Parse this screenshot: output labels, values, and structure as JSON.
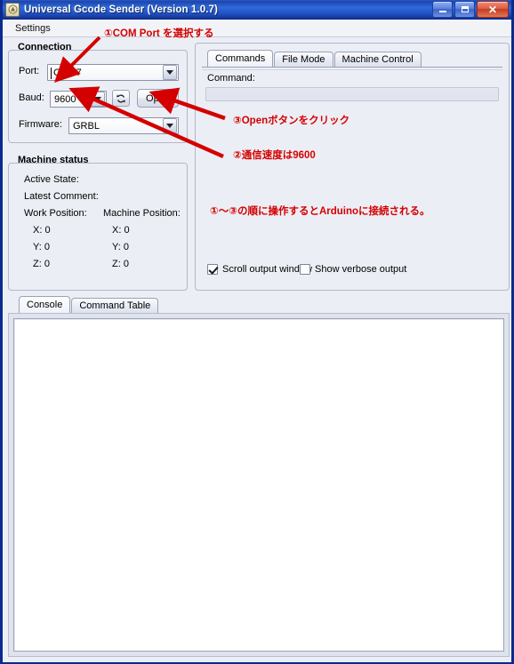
{
  "window": {
    "title": "Universal Gcode Sender (Version 1.0.7)",
    "app_icon": "gcode-app-icon",
    "minimize_label": "–",
    "maximize_label": "□",
    "close_label": "✕",
    "title_bar_color": "#1f4fc0",
    "close_button_color": "#c43c20"
  },
  "menubar": {
    "items": [
      {
        "label": "Settings"
      }
    ]
  },
  "connection": {
    "group_title": "Connection",
    "port": {
      "label": "Port:",
      "value": "COM7",
      "icon": "chevron-down-icon"
    },
    "baud": {
      "label": "Baud:",
      "value": "9600",
      "icon": "chevron-down-icon"
    },
    "firmware": {
      "label": "Firmware:",
      "value": "GRBL",
      "icon": "chevron-down-icon"
    },
    "refresh_icon": "refresh-icon",
    "open_button": "Open"
  },
  "machine_status": {
    "group_title": "Machine status",
    "active_state_label": "Active State:",
    "active_state_value": "",
    "latest_comment_label": "Latest Comment:",
    "latest_comment_value": "",
    "work_position_label": "Work Position:",
    "machine_position_label": "Machine Position:",
    "work": {
      "x": "X:  0",
      "y": "Y:  0",
      "z": "Z:  0"
    },
    "machine": {
      "x": "X:  0",
      "y": "Y:  0",
      "z": "Z:  0"
    }
  },
  "right_panel": {
    "tabs": [
      {
        "label": "Commands",
        "active": true
      },
      {
        "label": "File Mode",
        "active": false
      },
      {
        "label": "Machine Control",
        "active": false
      }
    ],
    "command_label": "Command:",
    "command_value": "",
    "checkboxes": [
      {
        "label": "Scroll output window",
        "checked": true
      },
      {
        "label": "Show verbose output",
        "checked": false
      }
    ]
  },
  "console": {
    "tabs": [
      {
        "label": "Console",
        "active": true
      },
      {
        "label": "Command Table",
        "active": false
      }
    ],
    "content": ""
  },
  "annotations": {
    "color": "#d40000",
    "items": [
      {
        "id": "anno-1",
        "text": "①COM Port を選択する"
      },
      {
        "id": "anno-3",
        "text": "③Openボタンをクリック"
      },
      {
        "id": "anno-2",
        "text": "②通信速度は9600"
      },
      {
        "id": "anno-summary",
        "text": "①～③の順に操作するとArduinoに接続される。"
      }
    ]
  }
}
